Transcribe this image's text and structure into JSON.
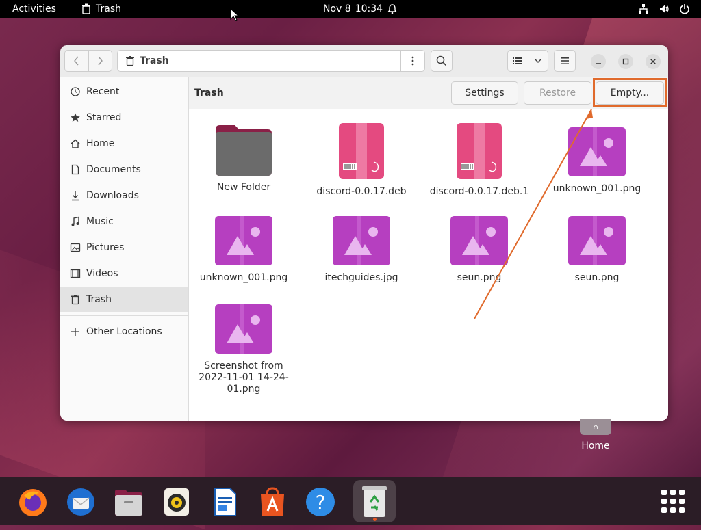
{
  "topbar": {
    "activities": "Activities",
    "app_name": "Trash",
    "date": "Nov 8",
    "time": "10:34"
  },
  "window": {
    "path": "Trash",
    "header_title": "Trash",
    "actions": {
      "settings": "Settings",
      "restore": "Restore",
      "empty": "Empty..."
    }
  },
  "sidebar": {
    "items": [
      {
        "label": "Recent",
        "icon": "clock-icon"
      },
      {
        "label": "Starred",
        "icon": "star-icon"
      },
      {
        "label": "Home",
        "icon": "home-icon"
      },
      {
        "label": "Documents",
        "icon": "document-icon"
      },
      {
        "label": "Downloads",
        "icon": "download-icon"
      },
      {
        "label": "Music",
        "icon": "music-icon"
      },
      {
        "label": "Pictures",
        "icon": "picture-icon"
      },
      {
        "label": "Videos",
        "icon": "video-icon"
      },
      {
        "label": "Trash",
        "icon": "trash-icon",
        "active": true
      }
    ],
    "other_locations": "Other Locations"
  },
  "files": [
    {
      "name": "New Folder",
      "type": "folder"
    },
    {
      "name": "discord-0.0.17.deb",
      "type": "deb"
    },
    {
      "name": "discord-0.0.17.deb.1",
      "type": "deb"
    },
    {
      "name": "unknown_001.png",
      "type": "image"
    },
    {
      "name": "unknown_001.png",
      "type": "image"
    },
    {
      "name": "itechguides.jpg",
      "type": "image"
    },
    {
      "name": "seun.png",
      "type": "image"
    },
    {
      "name": "seun.png",
      "type": "image"
    },
    {
      "name": "Screenshot from 2022-11-01 14-24-01.png",
      "type": "image"
    }
  ],
  "desktop": {
    "home_label": "Home"
  },
  "dock": {
    "apps": [
      "Firefox",
      "Thunderbird",
      "Files",
      "Rhythmbox",
      "LibreOffice Writer",
      "Ubuntu Software",
      "Help",
      "Trash"
    ]
  },
  "colors": {
    "accent": "#e95420",
    "highlight": "#e06a2c",
    "image_icon": "#b63fc0",
    "deb_icon": "#e0457b"
  }
}
